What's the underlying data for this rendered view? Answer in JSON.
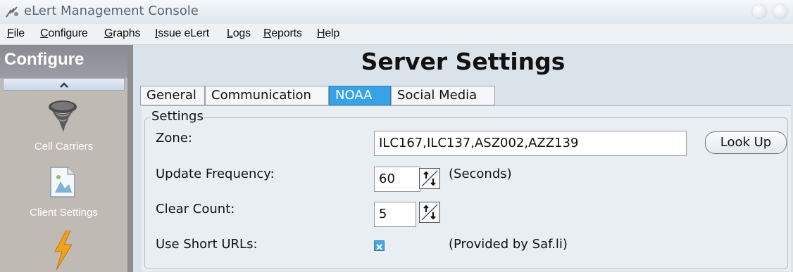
{
  "window": {
    "title": "eLert Management Console"
  },
  "menubar": {
    "items": [
      {
        "label_u": "F",
        "label_rest": "ile"
      },
      {
        "label_u": "C",
        "label_rest": "onfigure"
      },
      {
        "label_u": "G",
        "label_rest": "raphs"
      },
      {
        "label_u": "I",
        "label_rest": "ssue eLert"
      },
      {
        "label_u": "L",
        "label_rest": "ogs"
      },
      {
        "label_u": "R",
        "label_rest": "eports"
      },
      {
        "label_u": "H",
        "label_rest": "elp"
      }
    ]
  },
  "sidebar": {
    "header": "Configure",
    "items": [
      {
        "label": "Cell Carriers",
        "icon": "tornado-icon"
      },
      {
        "label": "Client Settings",
        "icon": "client-settings-icon"
      },
      {
        "label": "",
        "icon": "lightning-icon"
      }
    ]
  },
  "main": {
    "title": "Server Settings",
    "tabs": [
      {
        "label": "General",
        "active": false
      },
      {
        "label": "Communication",
        "active": false
      },
      {
        "label": "NOAA",
        "active": true
      },
      {
        "label": "Social Media",
        "active": false
      }
    ],
    "group_title": "Settings",
    "zone": {
      "label": "Zone:",
      "value": "ILC167,ILC137,ASZ002,AZZ139",
      "button": "Look Up"
    },
    "update_frequency": {
      "label": "Update Frequency:",
      "value": "60",
      "units": "(Seconds)"
    },
    "clear_count": {
      "label": "Clear Count:",
      "value": "5"
    },
    "short_urls": {
      "label": "Use Short URLs:",
      "checked": true,
      "note": "(Provided by Saf.li)"
    }
  },
  "colors": {
    "active_tab": "#38a2e6",
    "sidebar_bg": "#bfbab4",
    "sidebar_header": "#8a8a92",
    "panel_bg": "#e9eef2"
  }
}
